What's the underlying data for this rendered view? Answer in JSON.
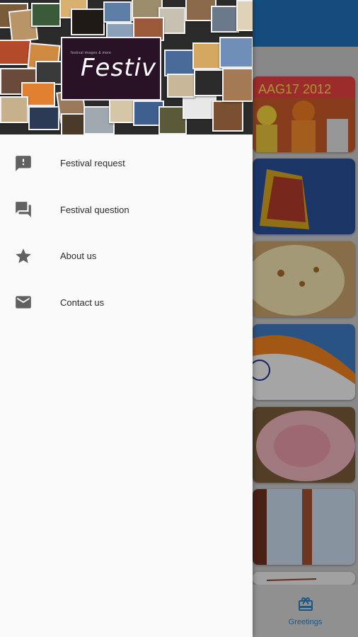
{
  "header": {
    "app_title": "Festiv",
    "tagline": "festival images & more"
  },
  "menu": [
    {
      "label": "Festival request",
      "icon": "feedback-icon"
    },
    {
      "label": "Festival question",
      "icon": "forum-icon"
    },
    {
      "label": "About us",
      "icon": "star-icon"
    },
    {
      "label": "Contact us",
      "icon": "mail-icon"
    }
  ],
  "bottom_nav": {
    "greetings_label": "Greetings",
    "icon": "gift-icon"
  },
  "colors": {
    "toolbar": "#1e72b8",
    "accent": "#2f7fbf",
    "icon": "#616161"
  }
}
